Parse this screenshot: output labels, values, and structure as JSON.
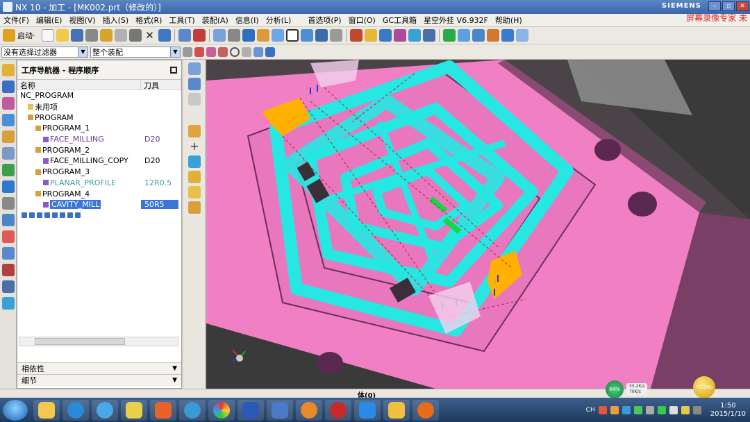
{
  "window": {
    "title": "NX 10 - 加工 - [MK002.prt（修改的）]",
    "brand": "SIEMENS",
    "watermark": "屏幕录像专家 未"
  },
  "menu": [
    "文件(F)",
    "编辑(E)",
    "视图(V)",
    "插入(S)",
    "格式(R)",
    "工具(T)",
    "装配(A)",
    "信息(I)",
    "分析(L)",
    "首选项(P)",
    "窗口(O)",
    "GC工具箱",
    "星空外挂 V6.932F",
    "帮助(H)"
  ],
  "toolbar": {
    "start_label": "启动·"
  },
  "filters": {
    "selection_filter": "没有选择过滤器",
    "assembly_scope": "整个装配"
  },
  "navigator": {
    "title": "工序导航器 - 程序顺序",
    "columns": [
      "名称",
      "刀具"
    ],
    "rows": [
      {
        "name": "NC_PROGRAM",
        "tool": "",
        "indent": 0,
        "icon": "none"
      },
      {
        "name": "未用项",
        "tool": "",
        "indent": 1,
        "icon": "folder"
      },
      {
        "name": "PROGRAM",
        "tool": "",
        "indent": 1,
        "icon": "program"
      },
      {
        "name": "PROGRAM_1",
        "tool": "",
        "indent": 2,
        "icon": "program"
      },
      {
        "name": "FACE_MILLING",
        "tool": "D20",
        "indent": 3,
        "icon": "operation",
        "color": "#6b3b8a"
      },
      {
        "name": "PROGRAM_2",
        "tool": "",
        "indent": 2,
        "icon": "program"
      },
      {
        "name": "FACE_MILLING_COPY",
        "tool": "D20",
        "indent": 3,
        "icon": "operation",
        "color": "#000000"
      },
      {
        "name": "PROGRAM_3",
        "tool": "",
        "indent": 2,
        "icon": "program"
      },
      {
        "name": "PLANAR_PROFILE",
        "tool": "12R0.5",
        "indent": 3,
        "icon": "operation",
        "color": "#3c9a9a"
      },
      {
        "name": "PROGRAM_4",
        "tool": "",
        "indent": 2,
        "icon": "program"
      },
      {
        "name": "CAVITY_MILL",
        "tool": "50R5",
        "indent": 3,
        "icon": "operation",
        "selected": true
      }
    ],
    "panels": [
      "相依性",
      "细节"
    ]
  },
  "status": {
    "text": "体(0)"
  },
  "taskbar": {
    "clock_time": "1:50",
    "clock_date": "2015/1/10",
    "net_percent": "64%",
    "net_speed_up": "35.2K/s",
    "net_speed_down": "70K/s",
    "coin_label": "72.0Kb",
    "ime": "CH"
  },
  "colors": {
    "mold": "#f07fc4",
    "toolpath": "#26e7e2",
    "highlight": "#ffb000",
    "select": "#3a76d6"
  }
}
